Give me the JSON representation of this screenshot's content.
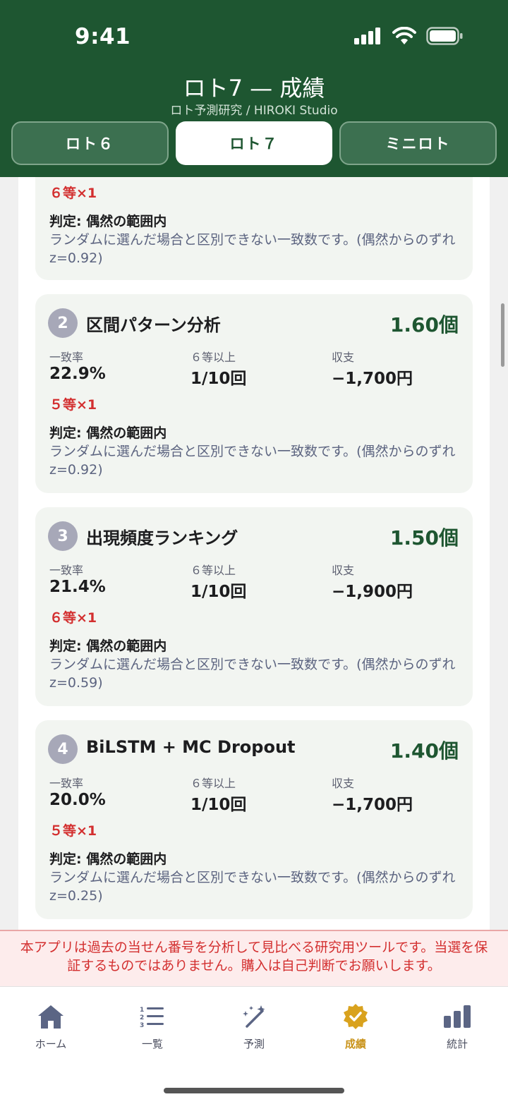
{
  "status": {
    "time": "9:41"
  },
  "header": {
    "title": "ロト7 — 成績",
    "subtitle": "ロト予測研究 / HIROKI Studio"
  },
  "segments": [
    {
      "label": "ロト６"
    },
    {
      "label": "ロト７"
    },
    {
      "label": "ミニロト"
    }
  ],
  "partial_card": {
    "prize": "６等×1",
    "verdict": "判定: 偶然の範囲内",
    "description": "ランダムに選んだ場合と区別できない一致数です。(偶然からのずれ z=0.92)"
  },
  "stat_labels": {
    "match_rate": "一致率",
    "hit_rate": "６等以上",
    "balance": "収支"
  },
  "cards": [
    {
      "rank": "2",
      "title": "区間パターン分析",
      "count": "1.60個",
      "match_rate": "22.9%",
      "hit_rate": "1/10回",
      "balance": "−1,700円",
      "prize": "５等×1",
      "verdict": "判定: 偶然の範囲内",
      "description": "ランダムに選んだ場合と区別できない一致数です。(偶然からのずれ z=0.92)"
    },
    {
      "rank": "3",
      "title": "出現頻度ランキング",
      "count": "1.50個",
      "match_rate": "21.4%",
      "hit_rate": "1/10回",
      "balance": "−1,900円",
      "prize": "６等×1",
      "verdict": "判定: 偶然の範囲内",
      "description": "ランダムに選んだ場合と区別できない一致数です。(偶然からのずれ z=0.59)"
    },
    {
      "rank": "4",
      "title": "BiLSTM + MC Dropout",
      "count": "1.40個",
      "match_rate": "20.0%",
      "hit_rate": "1/10回",
      "balance": "−1,700円",
      "prize": "５等×1",
      "verdict": "判定: 偶然の範囲内",
      "description": "ランダムに選んだ場合と区別できない一致数です。(偶然からのずれ z=0.25)"
    }
  ],
  "disclaimer": "本アプリは過去の当せん番号を分析して見比べる研究用ツールです。当選を保証するものではありません。購入は自己判断でお願いします。",
  "tabs": [
    {
      "label": "ホーム",
      "icon": "house-icon"
    },
    {
      "label": "一覧",
      "icon": "numbered-list-icon"
    },
    {
      "label": "予測",
      "icon": "magic-wand-icon"
    },
    {
      "label": "成績",
      "icon": "check-badge-icon"
    },
    {
      "label": "統計",
      "icon": "bar-chart-icon"
    }
  ],
  "colors": {
    "header_green": "#1e5631",
    "accent_gold": "#c9931a",
    "prize_red": "#d32f2f",
    "card_bg": "#f2f5f1"
  }
}
